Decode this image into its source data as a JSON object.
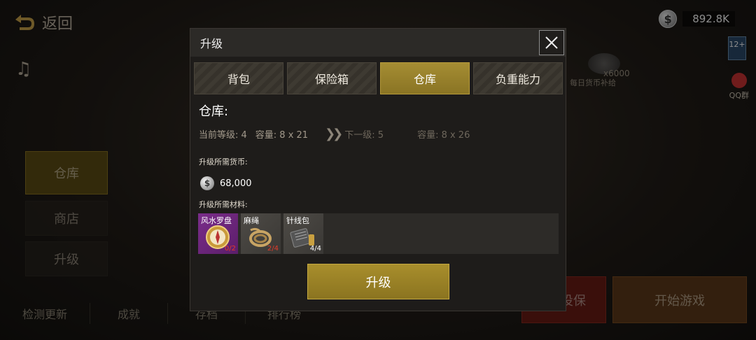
{
  "top": {
    "back_label": "返回",
    "currency_value": "892.8K",
    "coin_symbol": "$",
    "rating": "12+",
    "qq_label": "QQ群"
  },
  "bonus": {
    "amount": "x6000",
    "label": "每日货币补给"
  },
  "side_menu": [
    {
      "label": "仓库",
      "active": true
    },
    {
      "label": "商店",
      "active": false
    },
    {
      "label": "升级",
      "active": false
    }
  ],
  "bottom_menu": [
    "检测更新",
    "成就",
    "存档",
    "排行榜"
  ],
  "buttons": {
    "insurance": "投保",
    "start": "开始游戏"
  },
  "modal": {
    "title": "升级",
    "tabs": [
      {
        "label": "背包",
        "active": false
      },
      {
        "label": "保险箱",
        "active": false
      },
      {
        "label": "仓库",
        "active": true
      },
      {
        "label": "负重能力",
        "active": false
      }
    ],
    "section_title": "仓库:",
    "current": {
      "level_text": "当前等级: 4",
      "capacity_text": "容量: 8 x 21"
    },
    "next": {
      "level_text": "下一级: 5",
      "capacity_text": "容量: 8 x 26"
    },
    "currency_label": "升级所需货币:",
    "cost": "68,000",
    "materials_label": "升级所需材料:",
    "materials": [
      {
        "name": "风水罗盘",
        "count": "0/2",
        "color": "#e23a2a"
      },
      {
        "name": "麻绳",
        "count": "2/4",
        "color": "#e23a2a"
      },
      {
        "name": "针线包",
        "count": "4/4",
        "color": "#ffffff"
      }
    ],
    "upgrade_label": "升级"
  }
}
